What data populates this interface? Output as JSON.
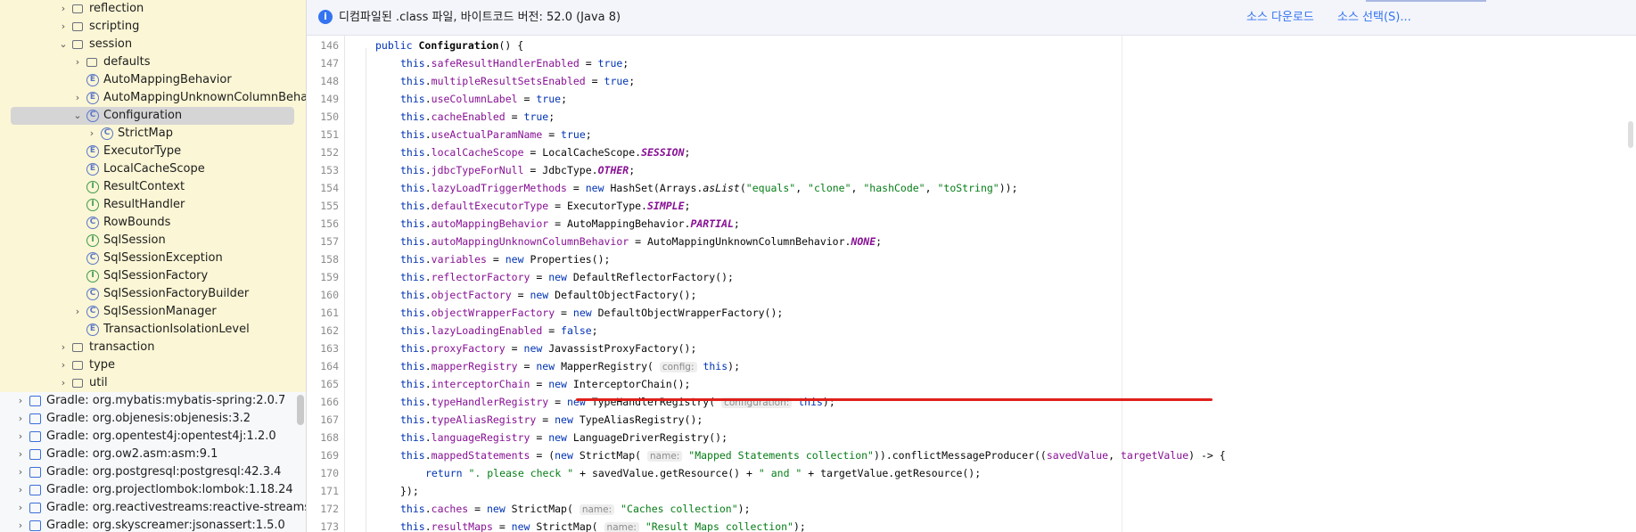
{
  "banner": {
    "message": "디컴파일된 .class 파일, 바이트코드 버전: 52.0 (Java 8)",
    "download_label": "소스 다운로드",
    "choose_label": "소스 선택(S)..."
  },
  "sidebar": {
    "items": [
      {
        "label": "reflection",
        "type": "folder",
        "indent": 4,
        "chev": "›"
      },
      {
        "label": "scripting",
        "type": "folder",
        "indent": 4,
        "chev": "›"
      },
      {
        "label": "session",
        "type": "folder",
        "indent": 4,
        "chev": "⌄"
      },
      {
        "label": "defaults",
        "type": "folder",
        "indent": 5,
        "chev": "›"
      },
      {
        "label": "AutoMappingBehavior",
        "type": "enum",
        "indent": 5,
        "chev": ""
      },
      {
        "label": "AutoMappingUnknownColumnBehavior",
        "type": "enum",
        "indent": 5,
        "chev": "›"
      },
      {
        "label": "Configuration",
        "type": "class",
        "indent": 5,
        "chev": "⌄",
        "selected": true
      },
      {
        "label": "StrictMap",
        "type": "class",
        "indent": 6,
        "chev": "›"
      },
      {
        "label": "ExecutorType",
        "type": "enum",
        "indent": 5,
        "chev": ""
      },
      {
        "label": "LocalCacheScope",
        "type": "enum",
        "indent": 5,
        "chev": ""
      },
      {
        "label": "ResultContext",
        "type": "interface",
        "indent": 5,
        "chev": ""
      },
      {
        "label": "ResultHandler",
        "type": "interface",
        "indent": 5,
        "chev": ""
      },
      {
        "label": "RowBounds",
        "type": "class",
        "indent": 5,
        "chev": ""
      },
      {
        "label": "SqlSession",
        "type": "interface",
        "indent": 5,
        "chev": ""
      },
      {
        "label": "SqlSessionException",
        "type": "class",
        "indent": 5,
        "chev": ""
      },
      {
        "label": "SqlSessionFactory",
        "type": "interface",
        "indent": 5,
        "chev": ""
      },
      {
        "label": "SqlSessionFactoryBuilder",
        "type": "class",
        "indent": 5,
        "chev": ""
      },
      {
        "label": "SqlSessionManager",
        "type": "class",
        "indent": 5,
        "chev": "›"
      },
      {
        "label": "TransactionIsolationLevel",
        "type": "enum",
        "indent": 5,
        "chev": ""
      },
      {
        "label": "transaction",
        "type": "folder",
        "indent": 4,
        "chev": "›"
      },
      {
        "label": "type",
        "type": "folder",
        "indent": 4,
        "chev": "›"
      },
      {
        "label": "util",
        "type": "folder",
        "indent": 4,
        "chev": "›"
      },
      {
        "label": "Gradle: org.mybatis:mybatis-spring:2.0.7",
        "type": "library",
        "indent": 1,
        "chev": "›"
      },
      {
        "label": "Gradle: org.objenesis:objenesis:3.2",
        "type": "library",
        "indent": 1,
        "chev": "›"
      },
      {
        "label": "Gradle: org.opentest4j:opentest4j:1.2.0",
        "type": "library",
        "indent": 1,
        "chev": "›"
      },
      {
        "label": "Gradle: org.ow2.asm:asm:9.1",
        "type": "library",
        "indent": 1,
        "chev": "›"
      },
      {
        "label": "Gradle: org.postgresql:postgresql:42.3.4",
        "type": "library",
        "indent": 1,
        "chev": "›"
      },
      {
        "label": "Gradle: org.projectlombok:lombok:1.18.24",
        "type": "library",
        "indent": 1,
        "chev": "›"
      },
      {
        "label": "Gradle: org.reactivestreams:reactive-streams",
        "type": "library",
        "indent": 1,
        "chev": "›"
      },
      {
        "label": "Gradle: org.skyscreamer:jsonassert:1.5.0",
        "type": "library",
        "indent": 1,
        "chev": "›"
      }
    ]
  },
  "editor": {
    "lines": [
      {
        "n": "146",
        "indent": 1,
        "tokens": [
          [
            "kw",
            "public "
          ],
          [
            "bold",
            "Configuration"
          ],
          [
            "",
            "() {"
          ]
        ]
      },
      {
        "n": "147",
        "indent": 2,
        "tokens": [
          [
            "kw",
            "this"
          ],
          [
            "",
            "."
          ],
          [
            "fld",
            "safeResultHandlerEnabled"
          ],
          [
            "",
            " = "
          ],
          [
            "kw",
            "true"
          ],
          [
            "",
            ";"
          ]
        ]
      },
      {
        "n": "148",
        "indent": 2,
        "tokens": [
          [
            "kw",
            "this"
          ],
          [
            "",
            "."
          ],
          [
            "fld",
            "multipleResultSetsEnabled"
          ],
          [
            "",
            " = "
          ],
          [
            "kw",
            "true"
          ],
          [
            "",
            ";"
          ]
        ]
      },
      {
        "n": "149",
        "indent": 2,
        "tokens": [
          [
            "kw",
            "this"
          ],
          [
            "",
            "."
          ],
          [
            "fld",
            "useColumnLabel"
          ],
          [
            "",
            " = "
          ],
          [
            "kw",
            "true"
          ],
          [
            "",
            ";"
          ]
        ]
      },
      {
        "n": "150",
        "indent": 2,
        "tokens": [
          [
            "kw",
            "this"
          ],
          [
            "",
            "."
          ],
          [
            "fld",
            "cacheEnabled"
          ],
          [
            "",
            " = "
          ],
          [
            "kw",
            "true"
          ],
          [
            "",
            ";"
          ]
        ]
      },
      {
        "n": "151",
        "indent": 2,
        "tokens": [
          [
            "kw",
            "this"
          ],
          [
            "",
            "."
          ],
          [
            "fld",
            "useActualParamName"
          ],
          [
            "",
            " = "
          ],
          [
            "kw",
            "true"
          ],
          [
            "",
            ";"
          ]
        ]
      },
      {
        "n": "152",
        "indent": 2,
        "tokens": [
          [
            "kw",
            "this"
          ],
          [
            "",
            "."
          ],
          [
            "fld",
            "localCacheScope"
          ],
          [
            "",
            " = LocalCacheScope."
          ],
          [
            "cst",
            "SESSION"
          ],
          [
            "",
            ";"
          ]
        ]
      },
      {
        "n": "153",
        "indent": 2,
        "tokens": [
          [
            "kw",
            "this"
          ],
          [
            "",
            "."
          ],
          [
            "fld",
            "jdbcTypeForNull"
          ],
          [
            "",
            " = JdbcType."
          ],
          [
            "cst",
            "OTHER"
          ],
          [
            "",
            ";"
          ]
        ]
      },
      {
        "n": "154",
        "indent": 2,
        "tokens": [
          [
            "kw",
            "this"
          ],
          [
            "",
            "."
          ],
          [
            "fld",
            "lazyLoadTriggerMethods"
          ],
          [
            "",
            " = "
          ],
          [
            "kw",
            "new "
          ],
          [
            "",
            "HashSet(Arrays."
          ],
          [
            "stc",
            "asList"
          ],
          [
            "",
            "("
          ],
          [
            "str",
            "\"equals\""
          ],
          [
            "",
            ", "
          ],
          [
            "str",
            "\"clone\""
          ],
          [
            "",
            ", "
          ],
          [
            "str",
            "\"hashCode\""
          ],
          [
            "",
            ", "
          ],
          [
            "str",
            "\"toString\""
          ],
          [
            "",
            "));"
          ]
        ]
      },
      {
        "n": "155",
        "indent": 2,
        "tokens": [
          [
            "kw",
            "this"
          ],
          [
            "",
            "."
          ],
          [
            "fld",
            "defaultExecutorType"
          ],
          [
            "",
            " = ExecutorType."
          ],
          [
            "cst",
            "SIMPLE"
          ],
          [
            "",
            ";"
          ]
        ]
      },
      {
        "n": "156",
        "indent": 2,
        "tokens": [
          [
            "kw",
            "this"
          ],
          [
            "",
            "."
          ],
          [
            "fld",
            "autoMappingBehavior"
          ],
          [
            "",
            " = AutoMappingBehavior."
          ],
          [
            "cst",
            "PARTIAL"
          ],
          [
            "",
            ";"
          ]
        ]
      },
      {
        "n": "157",
        "indent": 2,
        "tokens": [
          [
            "kw",
            "this"
          ],
          [
            "",
            "."
          ],
          [
            "fld",
            "autoMappingUnknownColumnBehavior"
          ],
          [
            "",
            " = AutoMappingUnknownColumnBehavior."
          ],
          [
            "cst",
            "NONE"
          ],
          [
            "",
            ";"
          ]
        ]
      },
      {
        "n": "158",
        "indent": 2,
        "tokens": [
          [
            "kw",
            "this"
          ],
          [
            "",
            "."
          ],
          [
            "fld",
            "variables"
          ],
          [
            "",
            " = "
          ],
          [
            "kw",
            "new "
          ],
          [
            "",
            "Properties();"
          ]
        ]
      },
      {
        "n": "159",
        "indent": 2,
        "tokens": [
          [
            "kw",
            "this"
          ],
          [
            "",
            "."
          ],
          [
            "fld",
            "reflectorFactory"
          ],
          [
            "",
            " = "
          ],
          [
            "kw",
            "new "
          ],
          [
            "",
            "DefaultReflectorFactory();"
          ]
        ]
      },
      {
        "n": "160",
        "indent": 2,
        "tokens": [
          [
            "kw",
            "this"
          ],
          [
            "",
            "."
          ],
          [
            "fld",
            "objectFactory"
          ],
          [
            "",
            " = "
          ],
          [
            "kw",
            "new "
          ],
          [
            "",
            "DefaultObjectFactory();"
          ]
        ]
      },
      {
        "n": "161",
        "indent": 2,
        "tokens": [
          [
            "kw",
            "this"
          ],
          [
            "",
            "."
          ],
          [
            "fld",
            "objectWrapperFactory"
          ],
          [
            "",
            " = "
          ],
          [
            "kw",
            "new "
          ],
          [
            "",
            "DefaultObjectWrapperFactory();"
          ]
        ]
      },
      {
        "n": "162",
        "indent": 2,
        "tokens": [
          [
            "kw",
            "this"
          ],
          [
            "",
            "."
          ],
          [
            "fld",
            "lazyLoadingEnabled"
          ],
          [
            "",
            " = "
          ],
          [
            "kw",
            "false"
          ],
          [
            "",
            ";"
          ]
        ]
      },
      {
        "n": "163",
        "indent": 2,
        "tokens": [
          [
            "kw",
            "this"
          ],
          [
            "",
            "."
          ],
          [
            "fld",
            "proxyFactory"
          ],
          [
            "",
            " = "
          ],
          [
            "kw",
            "new "
          ],
          [
            "",
            "JavassistProxyFactory();"
          ]
        ]
      },
      {
        "n": "164",
        "indent": 2,
        "tokens": [
          [
            "kw",
            "this"
          ],
          [
            "",
            "."
          ],
          [
            "fld",
            "mapperRegistry"
          ],
          [
            "",
            " = "
          ],
          [
            "kw",
            "new "
          ],
          [
            "",
            "MapperRegistry( "
          ],
          [
            "hint",
            "config:"
          ],
          [
            "",
            " "
          ],
          [
            "kw",
            "this"
          ],
          [
            "",
            ");"
          ]
        ]
      },
      {
        "n": "165",
        "indent": 2,
        "tokens": [
          [
            "kw",
            "this"
          ],
          [
            "",
            "."
          ],
          [
            "fld",
            "interceptorChain"
          ],
          [
            "",
            " = "
          ],
          [
            "kw",
            "new "
          ],
          [
            "",
            "InterceptorChain();"
          ]
        ]
      },
      {
        "n": "166",
        "indent": 2,
        "tokens": [
          [
            "kw",
            "this"
          ],
          [
            "",
            "."
          ],
          [
            "fld",
            "typeHandlerRegistry"
          ],
          [
            "",
            " = "
          ],
          [
            "kw",
            "new "
          ],
          [
            "",
            "TypeHandlerRegistry( "
          ],
          [
            "hint",
            "configuration:"
          ],
          [
            "",
            " "
          ],
          [
            "kw",
            "this"
          ],
          [
            "",
            ");"
          ]
        ]
      },
      {
        "n": "167",
        "indent": 2,
        "tokens": [
          [
            "kw",
            "this"
          ],
          [
            "",
            "."
          ],
          [
            "fld",
            "typeAliasRegistry"
          ],
          [
            "",
            " = "
          ],
          [
            "kw",
            "new "
          ],
          [
            "",
            "TypeAliasRegistry();"
          ]
        ]
      },
      {
        "n": "168",
        "indent": 2,
        "tokens": [
          [
            "kw",
            "this"
          ],
          [
            "",
            "."
          ],
          [
            "fld",
            "languageRegistry"
          ],
          [
            "",
            " = "
          ],
          [
            "kw",
            "new "
          ],
          [
            "",
            "LanguageDriverRegistry();"
          ]
        ]
      },
      {
        "n": "169",
        "indent": 2,
        "tokens": [
          [
            "kw",
            "this"
          ],
          [
            "",
            "."
          ],
          [
            "fld",
            "mappedStatements"
          ],
          [
            "",
            " = ("
          ],
          [
            "kw",
            "new "
          ],
          [
            "",
            "StrictMap( "
          ],
          [
            "hint",
            "name:"
          ],
          [
            "",
            " "
          ],
          [
            "str",
            "\"Mapped Statements collection\""
          ],
          [
            "",
            ")).conflictMessageProducer(("
          ],
          [
            "fld",
            "savedValue"
          ],
          [
            "",
            ", "
          ],
          [
            "fld",
            "targetValue"
          ],
          [
            "",
            ") -> {"
          ]
        ]
      },
      {
        "n": "170",
        "indent": 3,
        "tokens": [
          [
            "kw",
            "return "
          ],
          [
            "str",
            "\". please check \""
          ],
          [
            "",
            " + savedValue.getResource() + "
          ],
          [
            "str",
            "\" and \""
          ],
          [
            "",
            " + targetValue.getResource();"
          ]
        ]
      },
      {
        "n": "171",
        "indent": 2,
        "tokens": [
          [
            "",
            "});"
          ]
        ]
      },
      {
        "n": "172",
        "indent": 2,
        "tokens": [
          [
            "kw",
            "this"
          ],
          [
            "",
            "."
          ],
          [
            "fld",
            "caches"
          ],
          [
            "",
            " = "
          ],
          [
            "kw",
            "new "
          ],
          [
            "",
            "StrictMap( "
          ],
          [
            "hint",
            "name:"
          ],
          [
            "",
            " "
          ],
          [
            "str",
            "\"Caches collection\""
          ],
          [
            "",
            ");"
          ]
        ]
      },
      {
        "n": "173",
        "indent": 2,
        "tokens": [
          [
            "kw",
            "this"
          ],
          [
            "",
            "."
          ],
          [
            "fld",
            "resultMaps"
          ],
          [
            "",
            " = "
          ],
          [
            "kw",
            "new "
          ],
          [
            "",
            "StrictMap( "
          ],
          [
            "hint",
            "name:"
          ],
          [
            "",
            " "
          ],
          [
            "str",
            "\"Result Maps collection\""
          ],
          [
            "",
            ");"
          ]
        ]
      }
    ]
  }
}
